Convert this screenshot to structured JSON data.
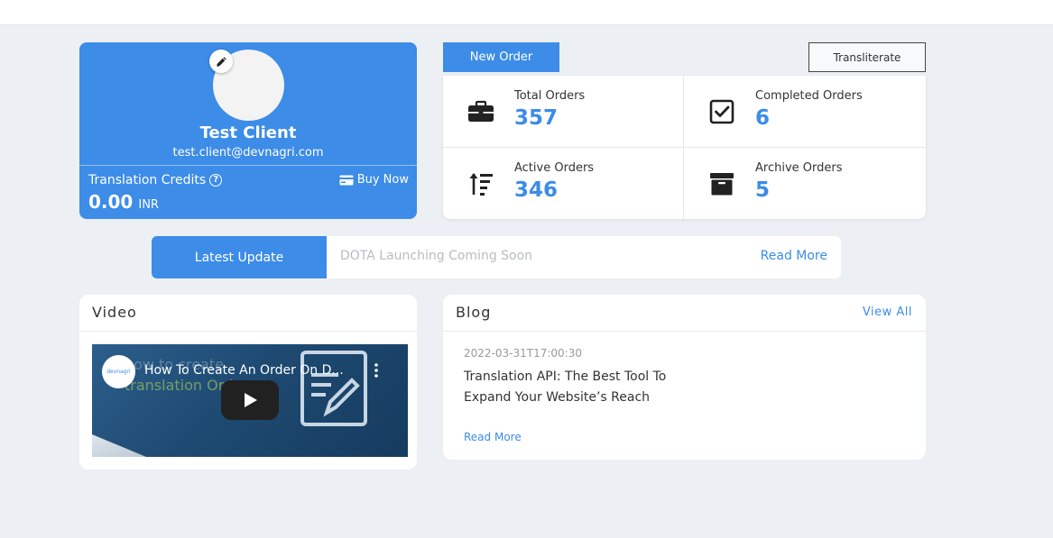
{
  "profile": {
    "name": "Test Client",
    "email": "test.client@devnagri.com",
    "credits_label": "Translation Credits",
    "credits_value": "0.00",
    "credits_currency": "INR",
    "buy_now_label": "Buy Now",
    "edit_icon": "pencil-icon",
    "help_icon": "question-circle-icon"
  },
  "actions": {
    "new_order_label": "New Order",
    "transliterate_label": "Transliterate"
  },
  "stats": [
    {
      "label": "Total Orders",
      "value": "357",
      "icon": "briefcase-icon"
    },
    {
      "label": "Completed Orders",
      "value": "6",
      "icon": "checkbox-icon"
    },
    {
      "label": "Active Orders",
      "value": "346",
      "icon": "sort-amount-up-icon"
    },
    {
      "label": "Archive Orders",
      "value": "5",
      "icon": "archive-box-icon"
    }
  ],
  "update": {
    "tag": "Latest Update",
    "message": "DOTA Launching Coming Soon",
    "read_more": "Read More"
  },
  "video": {
    "title": "Video",
    "video_title": "How To Create An Order On D...",
    "bg_text_1": "how to create",
    "bg_text_2": "translation Order",
    "channel_logo_text": "devnagri"
  },
  "blog": {
    "title": "Blog",
    "view_all": "View All",
    "date": "2022-03-31T17:00:30",
    "post_title": "Translation API: The Best Tool To Expand Your Website’s Reach",
    "read_more": "Read More"
  },
  "colors": {
    "primary": "#3c8ce8",
    "background": "#ecf0f4"
  }
}
